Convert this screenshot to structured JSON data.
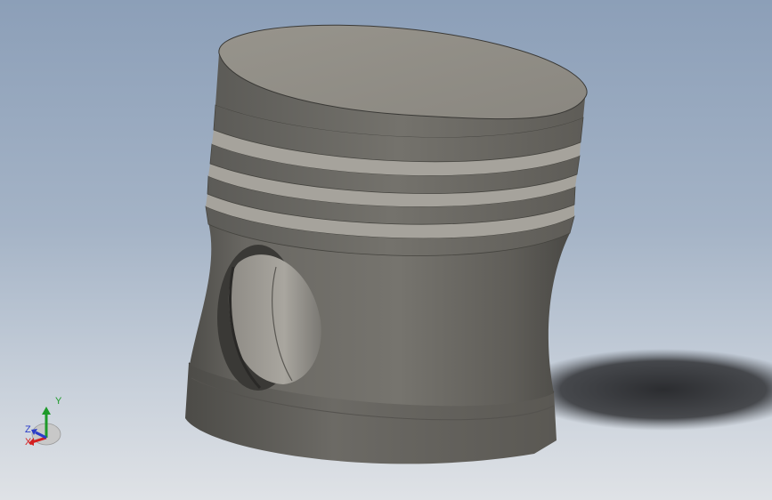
{
  "viewport": {
    "background_top": "#8c9fb8",
    "background_bottom": "#dfe2e6"
  },
  "model": {
    "name": "piston-3d-model",
    "body_color": "#6f6d68",
    "top_face_color": "#8e8b84",
    "shadow_color": "#2a2b2d"
  },
  "triad": {
    "y_label": "Y",
    "z_label": "Z",
    "x_label": "X",
    "y_color": "#1e9a2a",
    "x_color": "#d42020",
    "z_color": "#2a3cc8"
  }
}
